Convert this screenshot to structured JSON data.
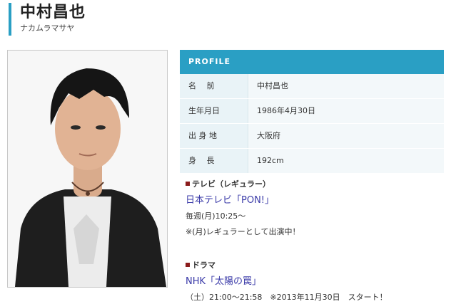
{
  "header": {
    "name": "中村昌也",
    "kana": "ナカムラマサヤ"
  },
  "profile": {
    "title": "PROFILE",
    "rows": [
      {
        "label": "名　 前",
        "value": "中村昌也"
      },
      {
        "label": "生年月日",
        "value": "1986年4月30日"
      },
      {
        "label": "出 身 地",
        "value": "大阪府"
      },
      {
        "label": "身　 長",
        "value": "192cm"
      }
    ]
  },
  "tv": {
    "heading": "テレビ（レギュラー）",
    "show": "日本テレビ「PON!」",
    "schedule": "毎週(月)10:25〜",
    "note": "※(月)レギュラーとして出演中！"
  },
  "drama": {
    "heading": "ドラマ",
    "show": "NHK「太陽の罠」",
    "schedule": "（土）21:00〜21:58　※2013年11月30日　スタート！"
  },
  "colors": {
    "accent": "#2a9fc4",
    "link": "#3a3aa8",
    "bullet": "#8b1c1c"
  }
}
